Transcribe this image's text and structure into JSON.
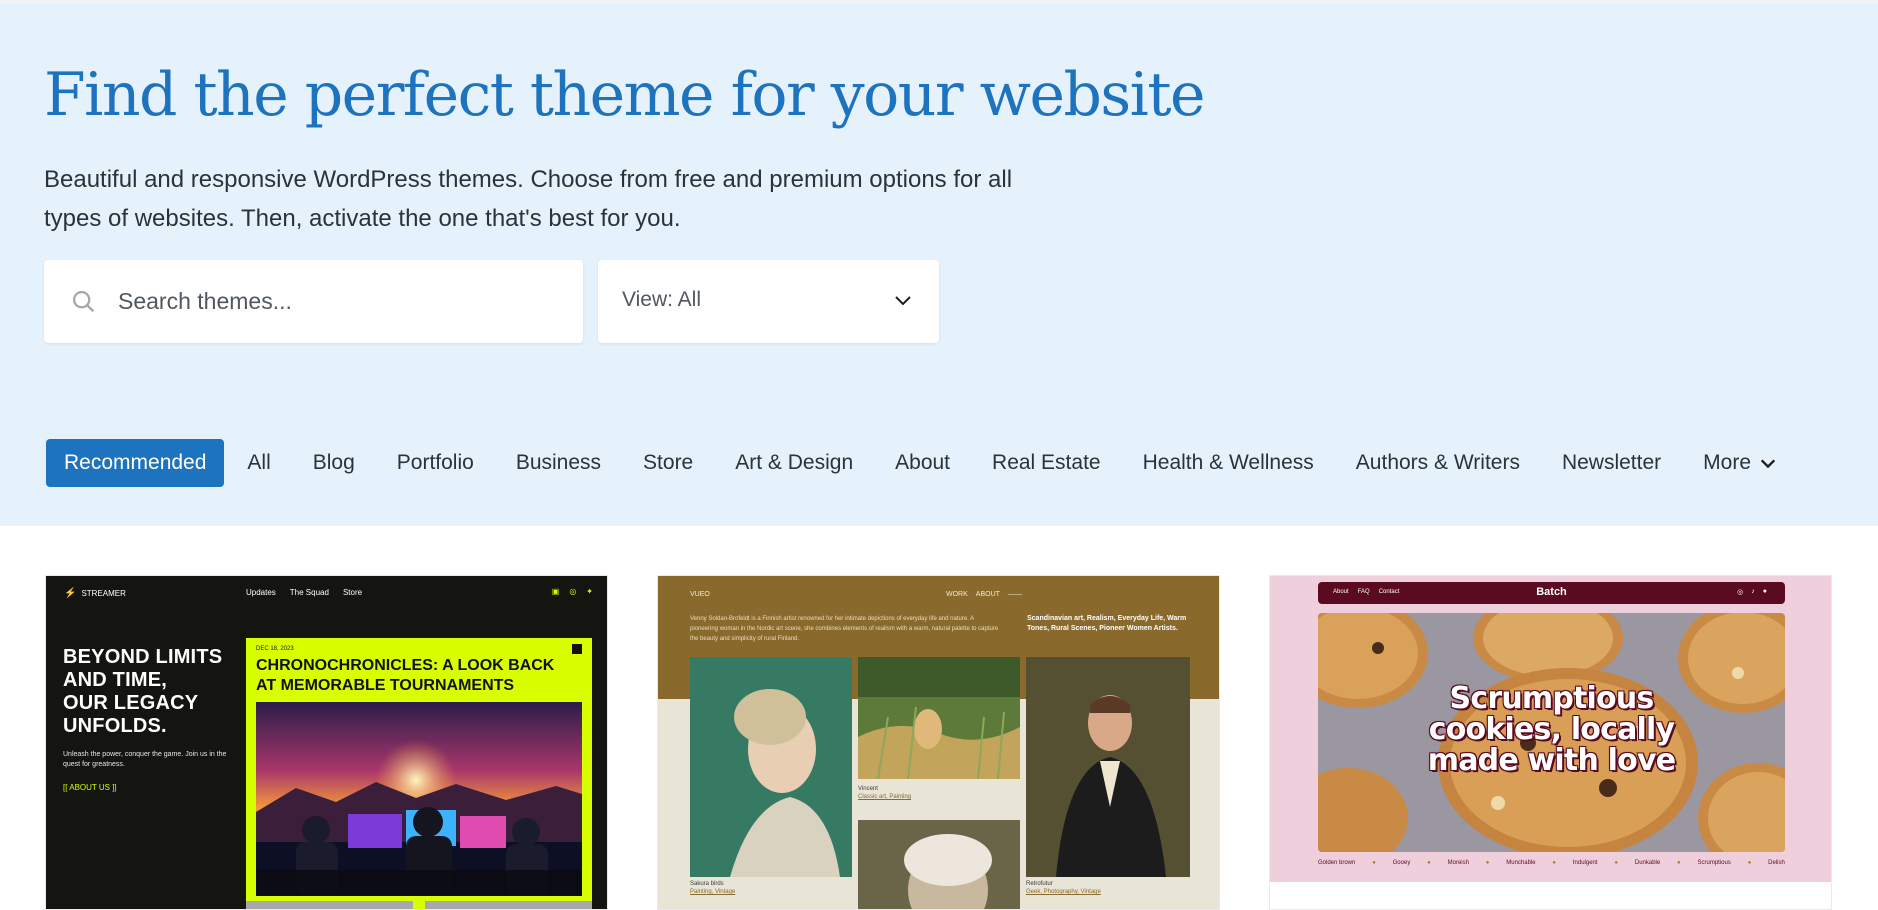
{
  "hero": {
    "title": "Find the perfect theme for your website",
    "description": "Beautiful and responsive WordPress themes. Choose from free and premium options for all types of websites. Then, activate the one that's best for you."
  },
  "search": {
    "placeholder": "Search themes...",
    "icon": "search-icon"
  },
  "view_filter": {
    "label": "View: All",
    "icon": "chevron-down-icon"
  },
  "tabs": [
    {
      "label": "Recommended",
      "active": true
    },
    {
      "label": "All"
    },
    {
      "label": "Blog"
    },
    {
      "label": "Portfolio"
    },
    {
      "label": "Business"
    },
    {
      "label": "Store"
    },
    {
      "label": "Art & Design"
    },
    {
      "label": "About"
    },
    {
      "label": "Real Estate"
    },
    {
      "label": "Health & Wellness"
    },
    {
      "label": "Authors & Writers"
    },
    {
      "label": "Newsletter"
    },
    {
      "label": "More"
    }
  ],
  "colors": {
    "accent": "#1e73be",
    "hero_bg": "#e5f2fc"
  },
  "themes": {
    "streamer": {
      "brand": "STREAMER",
      "nav": [
        "Updates",
        "The Squad",
        "Store"
      ],
      "headline_lines": [
        "BEYOND LIMITS",
        "AND TIME,",
        "OUR LEGACY",
        "UNFOLDS."
      ],
      "subtext": "Unleash the power, conquer the game. Join us in the quest for greatness.",
      "about_link": "[[ ABOUT US ]]",
      "feature_date": "DEC 18, 2023",
      "feature_title": "CHRONOCHRONICLES: A LOOK BACK AT MEMORABLE TOURNAMENTS"
    },
    "vueo": {
      "brand": "VUEO",
      "nav": [
        "WORK",
        "ABOUT"
      ],
      "intro": "Venny Soldan-Brofeldt is a Finnish artist renowned for her intimate depictions of everyday life and nature. A pioneering woman in the Nordic art scene, she combines elements of realism with a warm, natural palette to capture the beauty and simplicity of rural Finland.",
      "tags": "Scandinavian art, Realism, Everyday Life, Warm Tones, Rural Scenes, Pioneer Women Artists.",
      "captions": [
        {
          "title": "Sakura birds",
          "tags": "Painting, Vintage"
        },
        {
          "title": "Vincent",
          "tags": "Classic art, Painting"
        },
        {
          "title": "Retrofutur",
          "tags": "Geek, Photography, Vintage"
        }
      ]
    },
    "batch": {
      "brand": "Batch",
      "nav": [
        "About",
        "FAQ",
        "Contact"
      ],
      "hero_lines": [
        "Scrumptious",
        "cookies, locally",
        "made with love"
      ],
      "ticker": [
        "Golden brown",
        "Gooey",
        "Moreish",
        "Munchable",
        "Indulgent",
        "Dunkable",
        "Scrumptious",
        "Delish"
      ]
    }
  }
}
